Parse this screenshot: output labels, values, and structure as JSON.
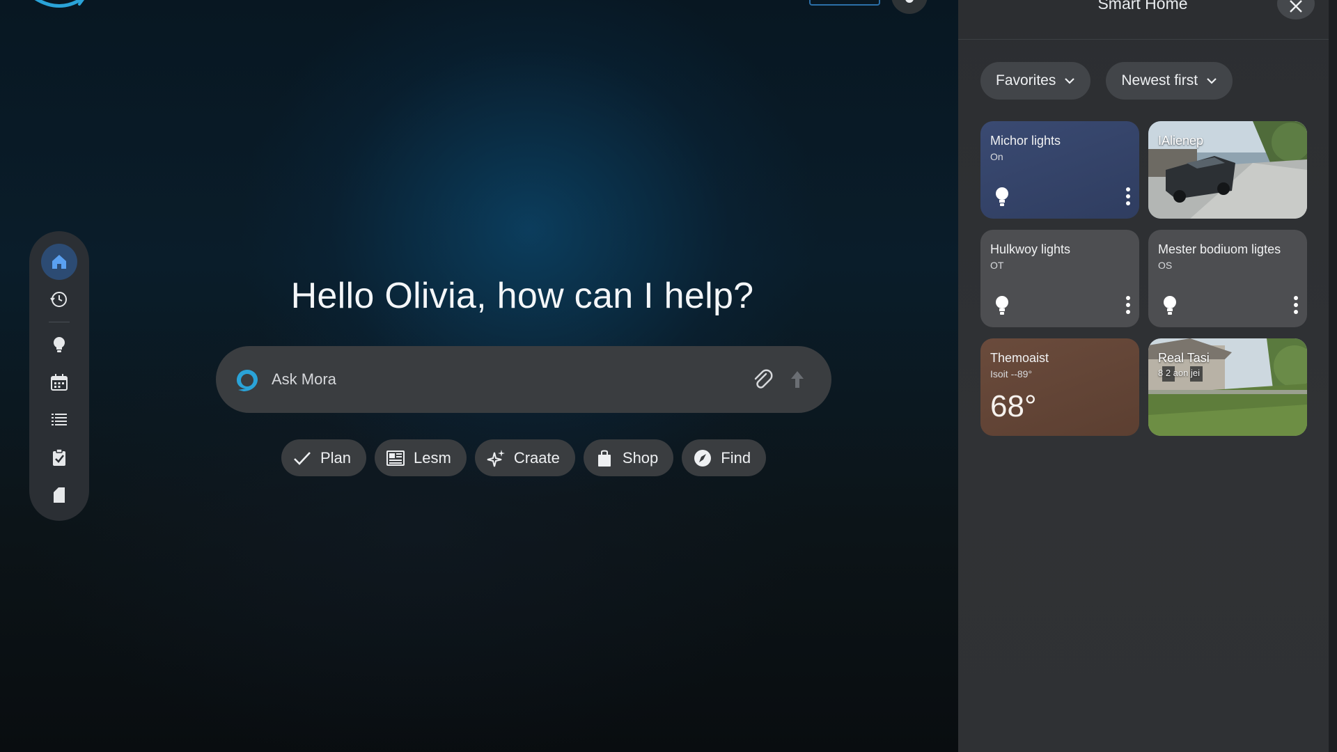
{
  "header": {
    "panel_title": "Smart Home"
  },
  "main": {
    "greeting": "Hello Olivia, how can I help?",
    "search": {
      "placeholder": "Ask Mora"
    },
    "chips": [
      {
        "label": "Plan",
        "icon": "checkmark-icon"
      },
      {
        "label": "Lesm",
        "icon": "newspaper-icon"
      },
      {
        "label": "Craate",
        "icon": "sparkle-icon"
      },
      {
        "label": "Shop",
        "icon": "shopping-bag-icon"
      },
      {
        "label": "Find",
        "icon": "compass-icon"
      }
    ]
  },
  "sidebar": {
    "items": [
      {
        "name": "home",
        "icon": "home-icon",
        "active": true
      },
      {
        "name": "history",
        "icon": "history-icon"
      },
      {
        "name": "smart-home",
        "icon": "lightbulb-icon"
      },
      {
        "name": "calendar",
        "icon": "calendar-icon"
      },
      {
        "name": "lists",
        "icon": "list-icon"
      },
      {
        "name": "tasks",
        "icon": "checklist-icon"
      },
      {
        "name": "documents",
        "icon": "document-icon"
      }
    ]
  },
  "panel": {
    "filters": [
      {
        "label": "Favorites"
      },
      {
        "label": "Newest first"
      }
    ],
    "tiles": [
      {
        "type": "light",
        "name": "Michor lights",
        "status": "On"
      },
      {
        "type": "camera",
        "name": "IAlienep"
      },
      {
        "type": "light",
        "name": "Hulkwoy lights",
        "status": "OT"
      },
      {
        "type": "light",
        "name": "Mester bodiuom ligtes",
        "status": "OS"
      },
      {
        "type": "thermostat",
        "name": "Themoaist",
        "status": "Isoit --89°",
        "temp": "68°"
      },
      {
        "type": "camera",
        "name": "Real Tasi",
        "sub": "8 2 aon jei"
      }
    ]
  },
  "colors": {
    "accent": "#2c4b73",
    "brand_blue": "#2aa3d8",
    "light_tile_on": "#3a4a72",
    "thermostat_tile": "#6a4b3c"
  }
}
